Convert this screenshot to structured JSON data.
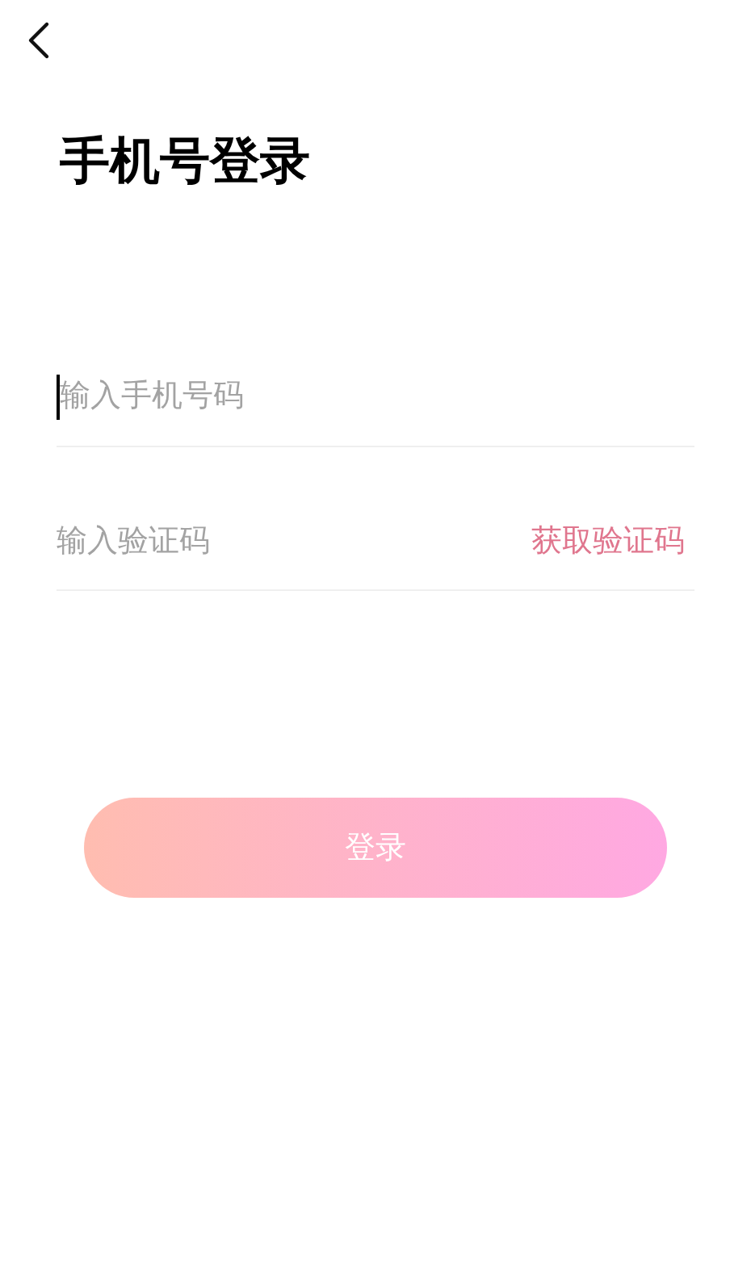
{
  "title": "手机号登录",
  "phone_field": {
    "placeholder": "输入手机号码",
    "focused": true
  },
  "code_field": {
    "placeholder": "输入验证码"
  },
  "get_code_link": "获取验证码",
  "login_button": "登录"
}
